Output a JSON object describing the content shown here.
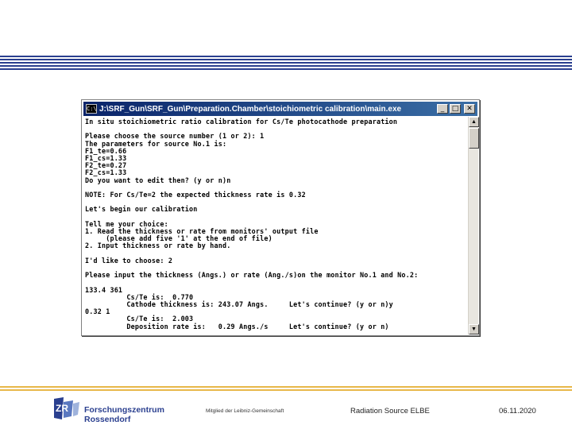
{
  "window": {
    "title": "J:\\SRF_Gun\\SRF_Gun\\Preparation.Chamber\\stoichiometric calibration\\main.exe",
    "icon_label": "C:\\",
    "minimize_icon": "minimize-icon",
    "maximize_icon": "maximize-icon",
    "close_icon": "close-icon"
  },
  "console": {
    "lines": [
      "In situ stoichiometric ratio calibration for Cs/Te photocathode preparation",
      "",
      "Please choose the source number (1 or 2): 1",
      "The parameters for source No.1 is:",
      "F1_te=0.66",
      "F1_cs=1.33",
      "F2_te=0.27",
      "F2_cs=1.33",
      "Do you want to edit then? (y or n)n",
      "",
      "NOTE: For Cs/Te=2 the expected thickness rate is 0.32",
      "",
      "Let's begin our calibration",
      "",
      "Tell me your choice:",
      "1. Read the thickness or rate from monitors' output file",
      "     (please add five '1' at the end of file)",
      "2. Input thickness or rate by hand.",
      "",
      "I'd like to choose: 2",
      "",
      "Please input the thickness (Angs.) or rate (Ang./s)on the monitor No.1 and No.2:",
      "",
      "133.4 361",
      "          Cs/Te is:  0.770",
      "          Cathode thickness is: 243.07 Angs.     Let's continue? (y or n)y",
      "0.32 1",
      "          Cs/Te is:  2.003",
      "          Deposition rate is:   0.29 Angs./s     Let's continue? (y or n)"
    ]
  },
  "footer": {
    "org_line1": "Forschungszentrum",
    "org_line2": "Rossendorf",
    "member": "Mitglied der Leibniz-Gemeinschaft",
    "source": "Radiation Source ELBE",
    "date": "06.11.2020"
  },
  "colors": {
    "stripe_blue": "#2a3f8f",
    "stripe_gold": "#e8b84a",
    "titlebar": "#0a246a"
  }
}
